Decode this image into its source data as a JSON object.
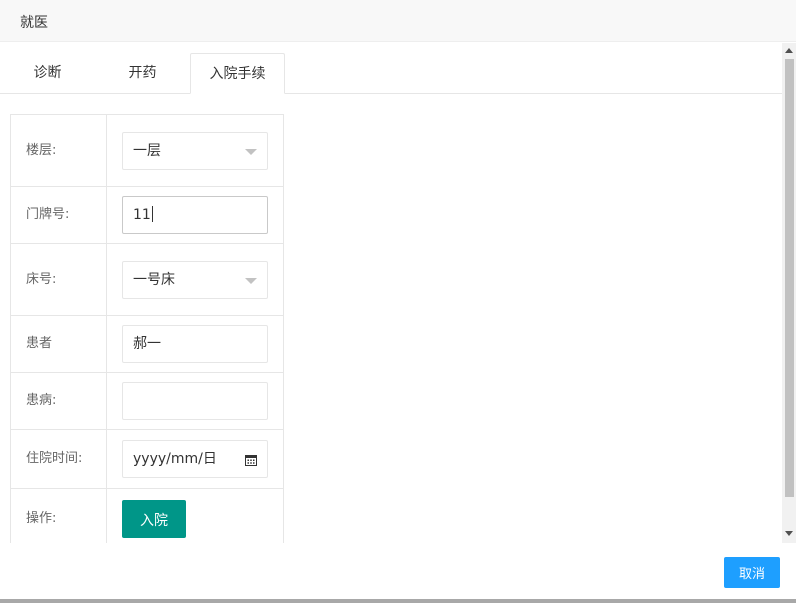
{
  "dialog": {
    "title": "就医"
  },
  "tabs": [
    {
      "label": "诊断"
    },
    {
      "label": "开药"
    },
    {
      "label": "入院手续"
    }
  ],
  "form": {
    "floor": {
      "label": "楼层:",
      "value": "一层"
    },
    "door_number": {
      "label": "门牌号:",
      "value": "11"
    },
    "bed_number": {
      "label": "床号:",
      "value": "一号床"
    },
    "patient": {
      "label": "患者",
      "value": "郝一"
    },
    "illness": {
      "label": "患病:",
      "value": ""
    },
    "admission_time": {
      "label": "住院时间:",
      "placeholder": "yyyy/mm/日"
    },
    "action": {
      "label": "操作:",
      "button": "入院"
    }
  },
  "footer": {
    "cancel": "取消"
  },
  "colors": {
    "primary_green": "#009688",
    "primary_blue": "#1e9fff"
  }
}
